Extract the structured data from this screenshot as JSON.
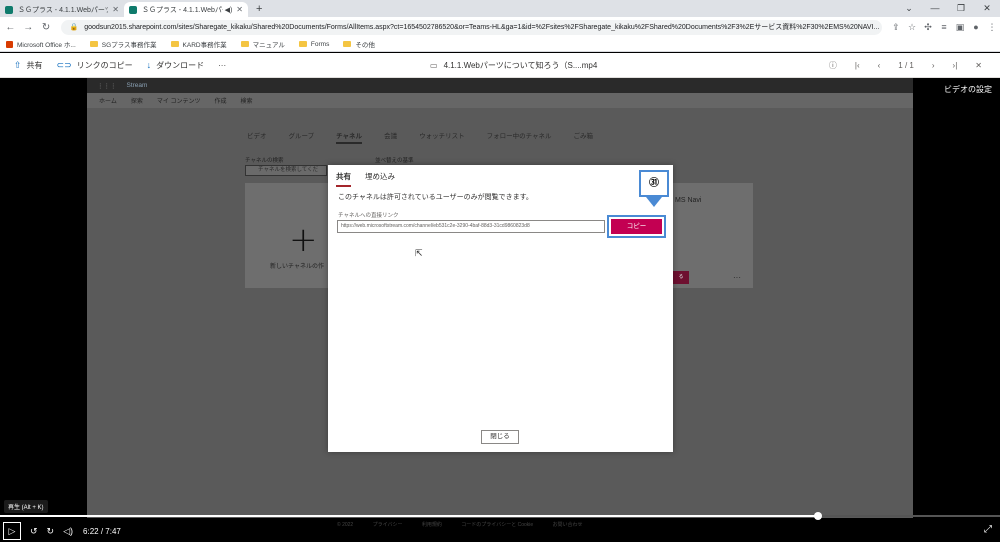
{
  "browser": {
    "tabs": [
      {
        "title": "ＳＧプラス - 4.1.1.Webパーツについ",
        "active": false
      },
      {
        "title": "ＳＧプラス - 4.1.1.Webパーツ",
        "active": true
      }
    ],
    "url": "goodsun2015.sharepoint.com/sites/Sharegate_kikaku/Shared%20Documents/Forms/AllItems.aspx?ct=1654502786520&or=Teams-HL&ga=1&id=%2Fsites%2FSharegate_kikaku%2FShared%20Documents%2F3%2Eサービス資料%2F30%2EMS%20NAVI...",
    "bookmarks": [
      "Microsoft Office ホ...",
      "SGプラス事務作業",
      "KARD事務作業",
      "マニュアル",
      "Forms",
      "その他"
    ]
  },
  "viewer_toolbar": {
    "share_label": "共有",
    "copy_link_label": "リンクのコピー",
    "download_label": "ダウンロード",
    "more_label": "···",
    "file_title": "4.1.1.Webパーツについて知ろう（S....mp4",
    "page_indicator": "1 / 1"
  },
  "stream": {
    "app_name": "Stream",
    "nav": [
      "ホーム",
      "探索",
      "マイ コンテンツ",
      "作成",
      "検索"
    ],
    "tabs": [
      "ビデオ",
      "グループ",
      "チャネル",
      "会議",
      "ウォッチリスト",
      "フォロー中のチャネル",
      "ごみ箱"
    ],
    "selected_tab": "チャネル",
    "search_label": "チャネルの検索",
    "search_placeholder": "チャネルを検索してくだ",
    "sort_label": "並べ替えの基準",
    "new_channel_label": "新しいチャネルの作",
    "channel_name": "MS Navi",
    "channel_button": "る",
    "card_more": "···",
    "footer": [
      "© 2022",
      "プライバシー",
      "利用規約",
      "コードのプライバシーと Cookie",
      "お問い合わせ"
    ]
  },
  "video_settings_label": "ビデオの設定",
  "dialog": {
    "tabs": [
      "共有",
      "埋め込み"
    ],
    "selected_tab": "共有",
    "message": "このチャネルは許可されているユーザーのみが閲覧できます。",
    "link_label": "チャネルへの直接リンク",
    "link_url": "https://web.microsoftstream.com/channel/eb531c2e-3290-4baf-88d3-31cd9860823d8",
    "copy_label": "コピー",
    "close_label": "閉じる",
    "callout_number": "㉛"
  },
  "player": {
    "tooltip": "再生 (Alt + K)",
    "current_time": "6:22",
    "duration": "7:47",
    "separator": "/",
    "progress_fraction": 0.818
  },
  "colors": {
    "copy_button": "#c30052",
    "callout_border": "#4a8ad4",
    "tab_underline": "#a4262c"
  }
}
